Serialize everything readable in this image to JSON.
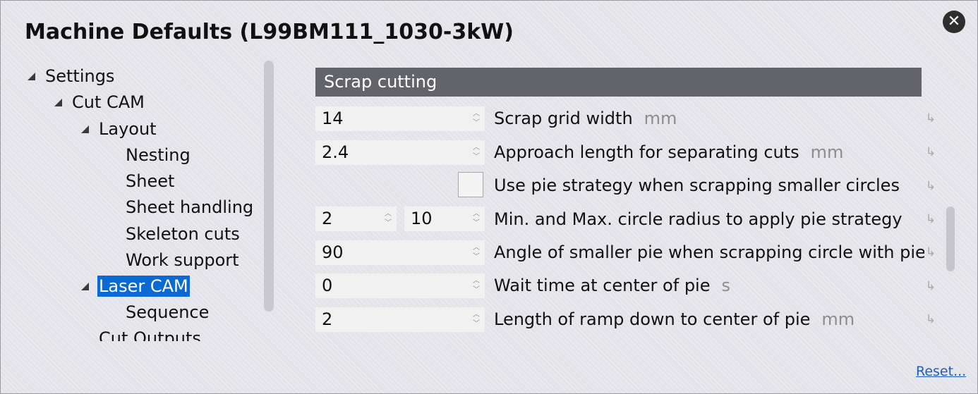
{
  "window": {
    "title": "Machine Defaults (L99BM111_1030-3kW)",
    "close_glyph": "✕"
  },
  "tree": {
    "items": [
      {
        "label": "Settings"
      },
      {
        "label": "Cut CAM"
      },
      {
        "label": "Layout"
      },
      {
        "label": "Nesting"
      },
      {
        "label": "Sheet"
      },
      {
        "label": "Sheet handling"
      },
      {
        "label": "Skeleton cuts"
      },
      {
        "label": "Work support"
      },
      {
        "label": "Laser CAM"
      },
      {
        "label": "Sequence"
      },
      {
        "label": "Cut Outputs"
      }
    ],
    "selected": "Laser CAM"
  },
  "section": {
    "title": "Scrap cutting"
  },
  "fields": [
    {
      "value": "14",
      "label": "Scrap grid width",
      "unit": "mm"
    },
    {
      "value": "2.4",
      "label": "Approach length for separating cuts",
      "unit": "mm"
    },
    {
      "checked": false,
      "label": "Use pie strategy when scrapping smaller circles",
      "unit": ""
    },
    {
      "value": "2",
      "value2": "10",
      "label": "Min. and Max. circle radius to apply pie strategy",
      "unit": ""
    },
    {
      "value": "90",
      "label": "Angle of smaller pie when scrapping circle with pie",
      "unit": ""
    },
    {
      "value": "0",
      "label": "Wait time at center of pie",
      "unit": "s"
    },
    {
      "value": "2",
      "label": "Length of ramp down to center of pie",
      "unit": "mm"
    }
  ],
  "icons": {
    "reset_row": "↳",
    "spin_up": "︿",
    "spin_down": "﹀"
  },
  "footer": {
    "reset_label": "Reset..."
  },
  "colors": {
    "section_bg": "#636469",
    "selection_bg": "#0a6ad2",
    "link": "#1f5fb8"
  }
}
